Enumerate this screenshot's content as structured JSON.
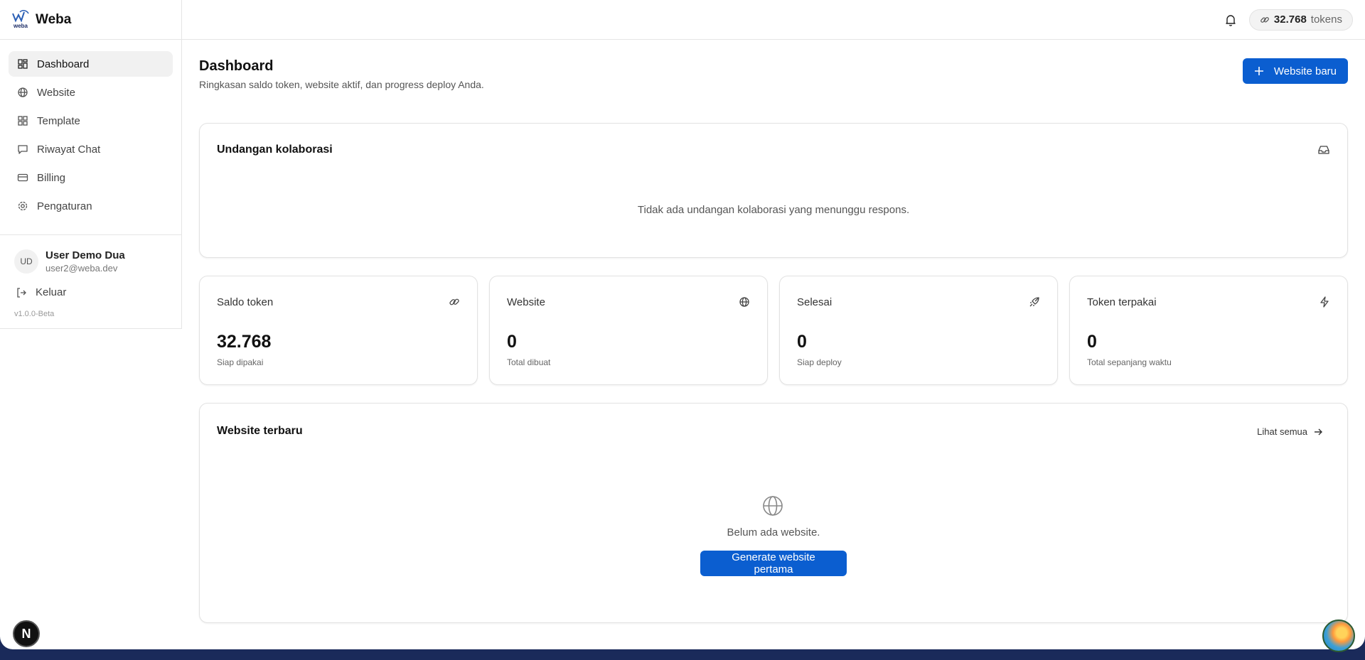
{
  "brand": {
    "name": "Weba",
    "logo_text": "weba"
  },
  "sidebar": {
    "items": [
      {
        "label": "Dashboard",
        "icon": "dashboard-icon",
        "active": true
      },
      {
        "label": "Website",
        "icon": "globe-icon"
      },
      {
        "label": "Template",
        "icon": "template-icon"
      },
      {
        "label": "Riwayat Chat",
        "icon": "chat-icon"
      },
      {
        "label": "Billing",
        "icon": "card-icon"
      },
      {
        "label": "Pengaturan",
        "icon": "gear-icon"
      }
    ],
    "user": {
      "initials": "UD",
      "name": "User Demo Dua",
      "email": "user2@weba.dev"
    },
    "logout_label": "Keluar",
    "version": "v1.0.0-Beta"
  },
  "header": {
    "token_count": "32.768",
    "token_unit": "tokens"
  },
  "page": {
    "title": "Dashboard",
    "subtitle": "Ringkasan saldo token, website aktif, dan progress deploy Anda.",
    "new_website_label": "Website baru"
  },
  "invitations": {
    "title": "Undangan kolaborasi",
    "empty_text": "Tidak ada undangan kolaborasi yang menunggu respons."
  },
  "stats": [
    {
      "label": "Saldo token",
      "value": "32.768",
      "note": "Siap dipakai",
      "icon": "link-icon"
    },
    {
      "label": "Website",
      "value": "0",
      "note": "Total dibuat",
      "icon": "globe-icon"
    },
    {
      "label": "Selesai",
      "value": "0",
      "note": "Siap deploy",
      "icon": "rocket-icon"
    },
    {
      "label": "Token terpakai",
      "value": "0",
      "note": "Total sepanjang waktu",
      "icon": "bolt-icon"
    }
  ],
  "recent": {
    "title": "Website terbaru",
    "see_all_label": "Lihat semua",
    "empty_text": "Belum ada website.",
    "generate_label": "Generate website pertama"
  },
  "floating": {
    "next_letter": "N"
  },
  "colors": {
    "primary": "#0b5ed0",
    "frame": "#1a2a5a"
  }
}
